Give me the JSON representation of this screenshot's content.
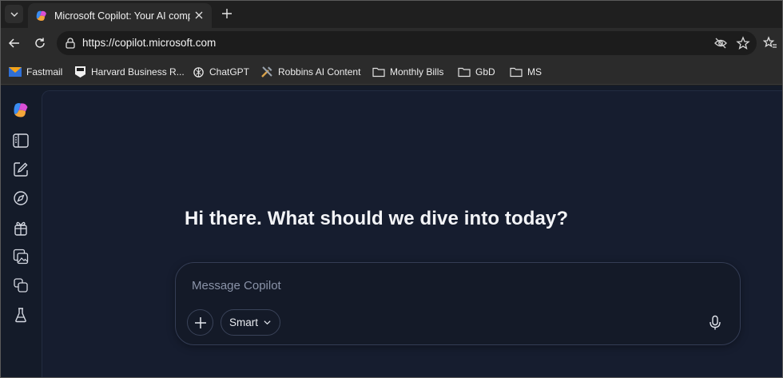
{
  "browser": {
    "tab": {
      "title": "Microsoft Copilot: Your AI companion",
      "favicon": "copilot-logo-icon"
    },
    "address_bar": {
      "url": "https://copilot.microsoft.com"
    },
    "bookmarks": [
      {
        "label": "Fastmail",
        "icon": "fastmail-icon"
      },
      {
        "label": "Harvard Business R...",
        "icon": "hbr-icon"
      },
      {
        "label": "ChatGPT",
        "icon": "chatgpt-icon"
      },
      {
        "label": "Robbins AI Content",
        "icon": "tools-icon"
      },
      {
        "label": "Monthly Bills",
        "icon": "folder-icon"
      },
      {
        "label": "GbD",
        "icon": "folder-icon"
      },
      {
        "label": "MS",
        "icon": "folder-icon"
      }
    ]
  },
  "sidebar": {
    "items": [
      {
        "icon": "copilot-logo-icon"
      },
      {
        "icon": "sidebar-toggle-icon"
      },
      {
        "icon": "new-chat-icon"
      },
      {
        "icon": "discover-icon"
      },
      {
        "icon": "gift-icon"
      },
      {
        "icon": "image-gallery-icon"
      },
      {
        "icon": "pages-icon"
      },
      {
        "icon": "labs-flask-icon"
      }
    ]
  },
  "main": {
    "greeting": "Hi there. What should we dive into today?",
    "composer": {
      "placeholder": "Message Copilot",
      "mode_label": "Smart"
    }
  },
  "colors": {
    "page_background": "#141b29",
    "composer_border": "#343d55",
    "placeholder": "#8a93a8"
  }
}
